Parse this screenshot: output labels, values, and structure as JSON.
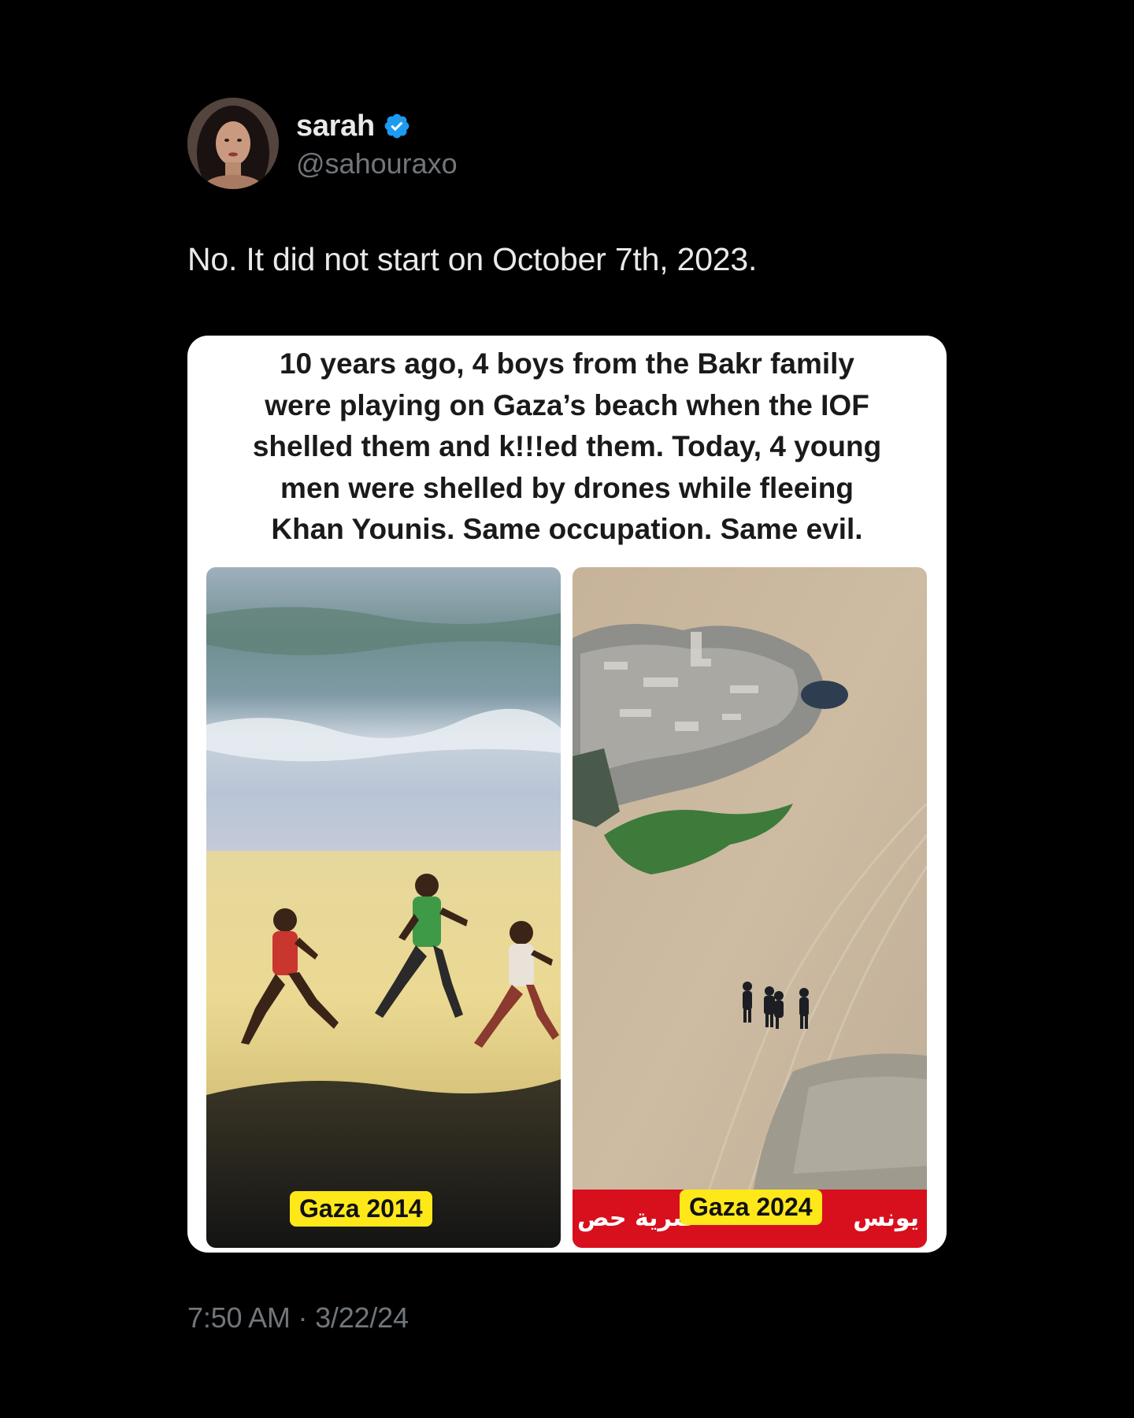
{
  "author": {
    "display_name": "sarah",
    "handle": "@sahouraxo",
    "verified": true,
    "avatar_icon": "profile-photo",
    "verified_icon": "verified-badge-icon",
    "verified_color": "#1d9bf0"
  },
  "tweet": {
    "text": "No. It did not start on October 7th, 2023.",
    "timestamp": "7:50 AM · 3/22/24"
  },
  "media": {
    "caption_lines": [
      "10 years ago, 4 boys from the Bakr family",
      "were playing on Gaza’s beach when the IOF",
      "shelled them and k!!!ed them. Today, 4 young",
      "men were shelled by drones while fleeing",
      "Khan Younis. Same occupation. Same evil."
    ],
    "left_photo": {
      "label": "Gaza 2014"
    },
    "right_photo": {
      "label": "Gaza 2024",
      "ticker_right": "يونس",
      "ticker_left": "صرية حص",
      "ticker_color": "#d8101d"
    },
    "badge_color": "#ffe81a"
  },
  "colors": {
    "background": "#000000",
    "primary_text": "#e7e9ea",
    "secondary_text": "#71767b",
    "media_background": "#ffffff"
  }
}
